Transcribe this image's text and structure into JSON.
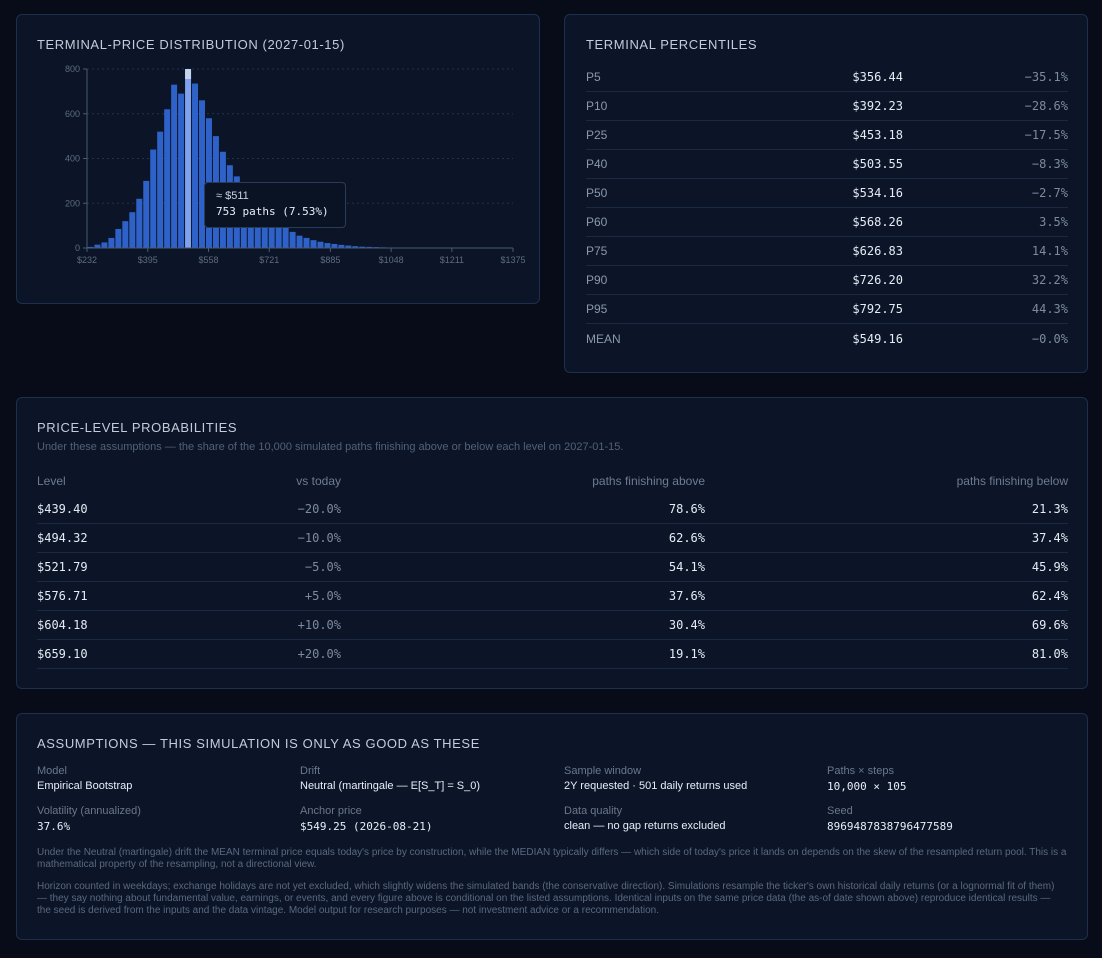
{
  "histogram": {
    "title": "TERMINAL-PRICE DISTRIBUTION (2027-01-15)",
    "tooltip": {
      "price": "≈ $511",
      "paths": "753 paths (7.53%)"
    },
    "chart_data": {
      "type": "bar",
      "y_ticks": [
        "0",
        "200",
        "400",
        "600",
        "800"
      ],
      "x_ticks": [
        "$232",
        "$395",
        "$558",
        "$721",
        "$885",
        "$1048",
        "$1211",
        "$1375"
      ],
      "ylim": [
        0,
        800
      ],
      "xlim": [
        232,
        1375
      ],
      "bin_width": 18.7,
      "bin_start": 232,
      "values": [
        5,
        15,
        25,
        45,
        85,
        120,
        160,
        220,
        300,
        440,
        520,
        620,
        730,
        690,
        800,
        735,
        660,
        580,
        500,
        430,
        370,
        320,
        250,
        215,
        190,
        165,
        140,
        110,
        90,
        72,
        55,
        45,
        35,
        28,
        22,
        18,
        14,
        11,
        8,
        6,
        5,
        4,
        3,
        2,
        2,
        1,
        1,
        1,
        1,
        1,
        0,
        1
      ],
      "highlight_index": 14,
      "grid": true
    },
    "colors": {
      "bar": "#2f62c9",
      "highlight": "#7fa2ee",
      "highlight_cap": "#c6d3ec"
    }
  },
  "percentiles": {
    "title": "TERMINAL PERCENTILES",
    "rows": [
      {
        "label": "P5",
        "price": "$356.44",
        "change": "−35.1%"
      },
      {
        "label": "P10",
        "price": "$392.23",
        "change": "−28.6%"
      },
      {
        "label": "P25",
        "price": "$453.18",
        "change": "−17.5%"
      },
      {
        "label": "P40",
        "price": "$503.55",
        "change": "−8.3%"
      },
      {
        "label": "P50",
        "price": "$534.16",
        "change": "−2.7%"
      },
      {
        "label": "P60",
        "price": "$568.26",
        "change": "3.5%"
      },
      {
        "label": "P75",
        "price": "$626.83",
        "change": "14.1%"
      },
      {
        "label": "P90",
        "price": "$726.20",
        "change": "32.2%"
      },
      {
        "label": "P95",
        "price": "$792.75",
        "change": "44.3%"
      },
      {
        "label": "MEAN",
        "price": "$549.16",
        "change": "−0.0%"
      }
    ]
  },
  "probabilities": {
    "title": "PRICE-LEVEL PROBABILITIES",
    "subtitle": "Under these assumptions — the share of the 10,000 simulated paths finishing above or below each level on 2027-01-15.",
    "headers": {
      "level": "Level",
      "vs_today": "vs today",
      "above": "paths finishing above",
      "below": "paths finishing below"
    },
    "rows": [
      {
        "level": "$439.40",
        "vs_today": "−20.0%",
        "above": "78.6%",
        "below": "21.3%"
      },
      {
        "level": "$494.32",
        "vs_today": "−10.0%",
        "above": "62.6%",
        "below": "37.4%"
      },
      {
        "level": "$521.79",
        "vs_today": "−5.0%",
        "above": "54.1%",
        "below": "45.9%"
      },
      {
        "level": "$576.71",
        "vs_today": "+5.0%",
        "above": "37.6%",
        "below": "62.4%"
      },
      {
        "level": "$604.18",
        "vs_today": "+10.0%",
        "above": "30.4%",
        "below": "69.6%"
      },
      {
        "level": "$659.10",
        "vs_today": "+20.0%",
        "above": "19.1%",
        "below": "81.0%"
      }
    ]
  },
  "assumptions": {
    "title": "ASSUMPTIONS — THIS SIMULATION IS ONLY AS GOOD AS THESE",
    "model": {
      "label": "Model",
      "value": "Empirical Bootstrap"
    },
    "drift": {
      "label": "Drift",
      "value": "Neutral (martingale — E[S_T] = S_0)"
    },
    "sample_window": {
      "label": "Sample window",
      "value": "2Y requested · 501 daily returns used"
    },
    "paths_steps": {
      "label": "Paths × steps",
      "value": "10,000 × 105"
    },
    "volatility": {
      "label": "Volatility (annualized)",
      "value": "37.6%"
    },
    "anchor_price": {
      "label": "Anchor price",
      "value": "$549.25 (2026-08-21)"
    },
    "data_quality": {
      "label": "Data quality",
      "value": "clean — no gap returns excluded"
    },
    "seed": {
      "label": "Seed",
      "value": "8969487838796477589"
    },
    "note1": "Under the Neutral (martingale) drift the MEAN terminal price equals today's price by construction, while the MEDIAN typically differs — which side of today's price it lands on depends on the skew of the resampled return pool. This is a mathematical property of the resampling, not a directional view.",
    "note2": "Horizon counted in weekdays; exchange holidays are not yet excluded, which slightly widens the simulated bands (the conservative direction). Simulations resample the ticker's own historical daily returns (or a lognormal fit of them) — they say nothing about fundamental value, earnings, or events, and every figure above is conditional on the listed assumptions. Identical inputs on the same price data (the as-of date shown above) reproduce identical results — the seed is derived from the inputs and the data vintage. Model output for research purposes — not investment advice or a recommendation."
  }
}
